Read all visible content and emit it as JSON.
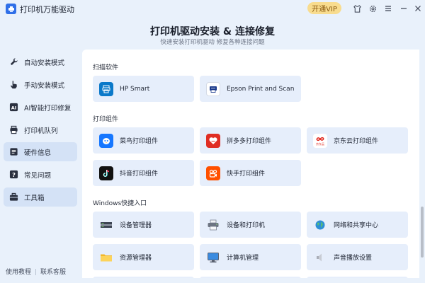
{
  "app": {
    "title": "打印机万能驱动",
    "vip_label": "开通VIP",
    "accent": "#2f6fe8"
  },
  "header": {
    "title": "打印机驱动安装 & 连接修复",
    "subtitle": "快速安装打印机驱动   修复各种连接问题"
  },
  "sidebar": {
    "items": [
      {
        "label": "自动安装模式",
        "icon": "wrench-icon",
        "active": false
      },
      {
        "label": "手动安装模式",
        "icon": "hand-pointer-icon",
        "active": false
      },
      {
        "label": "AI智能打印修复",
        "icon": "ai-icon",
        "active": false
      },
      {
        "label": "打印机队列",
        "icon": "printer-icon",
        "active": false
      },
      {
        "label": "硬件信息",
        "icon": "hardware-icon",
        "active": true
      },
      {
        "label": "常见问题",
        "icon": "question-icon",
        "active": false
      },
      {
        "label": "工具箱",
        "icon": "toolbox-icon",
        "active": true
      }
    ],
    "footer": {
      "tutorial": "使用教程",
      "support": "联系客服"
    }
  },
  "sections": {
    "scan": {
      "label": "扫描软件",
      "cards": [
        "HP Smart",
        "Epson Print and Scan"
      ]
    },
    "components": {
      "label": "打印组件",
      "cards": [
        "菜鸟打印组件",
        "拼多多打印组件",
        "京东云打印组件",
        "抖音打印组件",
        "快手打印组件"
      ]
    },
    "windows": {
      "label": "Windows快捷入口",
      "cards": [
        "设备管理器",
        "设备和打印机",
        "网络和共享中心",
        "资源管理器",
        "计算机管理",
        "声音播放设置"
      ]
    }
  },
  "icon_text": {
    "jd": "京东云"
  }
}
